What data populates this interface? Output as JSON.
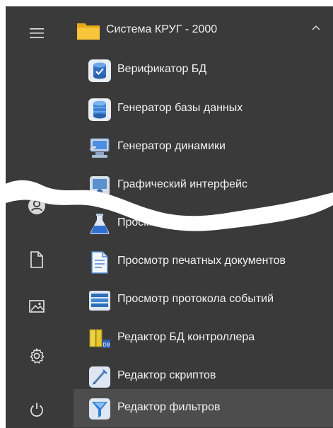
{
  "group": {
    "title": "Система КРУГ - 2000"
  },
  "items": [
    {
      "label": "Верификатор БД",
      "icon": "database-check-icon"
    },
    {
      "label": "Генератор базы данных",
      "icon": "database-icon"
    },
    {
      "label": "Генератор динамики",
      "icon": "monitor-generator-icon"
    },
    {
      "label": "Графический интерфейс",
      "icon": "graphics-interface-icon"
    },
    {
      "label": "Просмотр",
      "icon": "flask-view-icon"
    },
    {
      "label": "Просмотр печатных документов",
      "icon": "document-view-icon"
    },
    {
      "label": "Просмотр протокола событий",
      "icon": "event-log-icon"
    },
    {
      "label": "Редактор БД контроллера",
      "icon": "controller-db-icon"
    },
    {
      "label": "Редактор скриптов",
      "icon": "script-editor-icon"
    },
    {
      "label": "Редактор фильтров",
      "icon": "filter-editor-icon"
    }
  ],
  "rail": [
    "hamburger-menu-icon",
    "user-account-icon",
    "documents-icon",
    "pictures-icon",
    "settings-icon",
    "power-icon"
  ],
  "active_item": "Редактор фильтров"
}
